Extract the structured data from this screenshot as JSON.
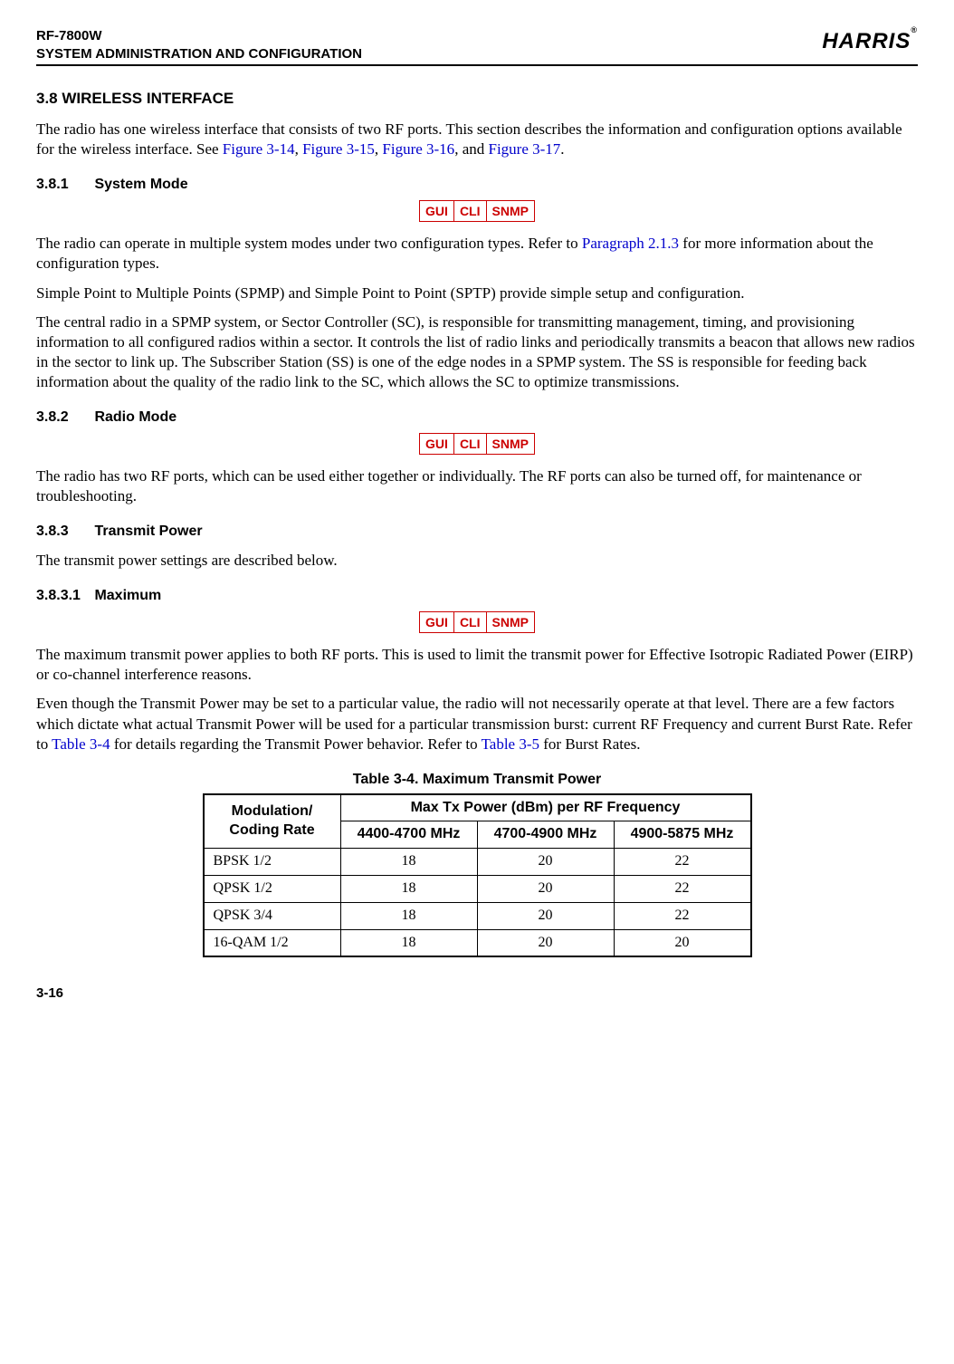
{
  "header": {
    "line1": "RF-7800W",
    "line2": "SYSTEM ADMINISTRATION AND CONFIGURATION",
    "brand": "HARRIS",
    "reg": "®"
  },
  "s38": {
    "heading": "3.8       WIRELESS INTERFACE",
    "p1a": "The radio has one wireless interface that consists of two RF ports. This section describes the information and configuration options available for the wireless interface. See ",
    "link1": "Figure 3-14",
    "sep1": ", ",
    "link2": "Figure 3-15",
    "sep2": ", ",
    "link3": "Figure 3-16",
    "sep3": ", and ",
    "link4": "Figure 3-17",
    "p1end": "."
  },
  "s381": {
    "heading_num": "3.8.1",
    "heading_title": "System Mode",
    "badges": [
      "GUI",
      "CLI",
      "SNMP"
    ],
    "p1a": "The radio can operate in multiple system modes under two configuration types. Refer to ",
    "link1": "Paragraph 2.1.3",
    "p1b": " for more information about the configuration types.",
    "p2": "Simple Point to Multiple Points (SPMP) and Simple Point to Point (SPTP) provide simple setup and configuration.",
    "p3": "The central radio in a SPMP system, or Sector Controller (SC), is responsible for transmitting management, timing, and provisioning information to all configured radios within a sector. It controls the list of radio links and periodically transmits a beacon that allows new radios in the sector to link up. The Subscriber Station (SS) is one of the edge nodes in a SPMP system. The SS is responsible for feeding back information about the quality of the radio link to the SC, which allows the SC to optimize transmissions."
  },
  "s382": {
    "heading_num": "3.8.2",
    "heading_title": "Radio Mode",
    "badges": [
      "GUI",
      "CLI",
      "SNMP"
    ],
    "p1": "The radio has two RF ports, which can be used either together or individually. The RF ports can also be turned off, for maintenance or troubleshooting."
  },
  "s383": {
    "heading_num": "3.8.3",
    "heading_title": "Transmit Power",
    "p1": "The transmit power settings are described below."
  },
  "s3831": {
    "heading_num": "3.8.3.1",
    "heading_title": "Maximum",
    "badges": [
      "GUI",
      "CLI",
      "SNMP"
    ],
    "p1": "The maximum transmit power applies to both RF ports. This is used to limit the transmit power for Effective Isotropic Radiated Power (EIRP) or co-channel interference reasons.",
    "p2a": "Even though the Transmit Power may be set to a particular value, the radio will not necessarily operate at that level. There are a few factors which dictate what actual Transmit Power will be used for a particular transmission burst: current RF Frequency and current Burst Rate. Refer to ",
    "link1": "Table 3-4",
    "p2b": " for details regarding the Transmit Power behavior. Refer to ",
    "link2": "Table 3-5",
    "p2c": " for Burst Rates."
  },
  "table": {
    "caption": "Table 3-4.  Maximum Transmit Power",
    "h1": "Modulation/ Coding Rate",
    "h2": "Max Tx Power (dBm) per RF Frequency",
    "h2a": "4400-4700 MHz",
    "h2b": "4700-4900 MHz",
    "h2c": "4900-5875 MHz",
    "rows": [
      {
        "c1": "BPSK 1/2",
        "v1": "18",
        "v2": "20",
        "v3": "22"
      },
      {
        "c1": "QPSK 1/2",
        "v1": "18",
        "v2": "20",
        "v3": "22"
      },
      {
        "c1": "QPSK 3/4",
        "v1": "18",
        "v2": "20",
        "v3": "22"
      },
      {
        "c1": "16-QAM 1/2",
        "v1": "18",
        "v2": "20",
        "v3": "20"
      }
    ]
  },
  "chart_data": {
    "type": "table",
    "title": "Table 3-4. Maximum Transmit Power",
    "columns": [
      "Modulation/Coding Rate",
      "4400-4700 MHz",
      "4700-4900 MHz",
      "4900-5875 MHz"
    ],
    "rows": [
      [
        "BPSK 1/2",
        18,
        20,
        22
      ],
      [
        "QPSK 1/2",
        18,
        20,
        22
      ],
      [
        "QPSK 3/4",
        18,
        20,
        22
      ],
      [
        "16-QAM 1/2",
        18,
        20,
        20
      ]
    ],
    "xlabel": "",
    "ylabel": "Max Tx Power (dBm) per RF Frequency"
  },
  "footer": {
    "page": "3-16"
  }
}
